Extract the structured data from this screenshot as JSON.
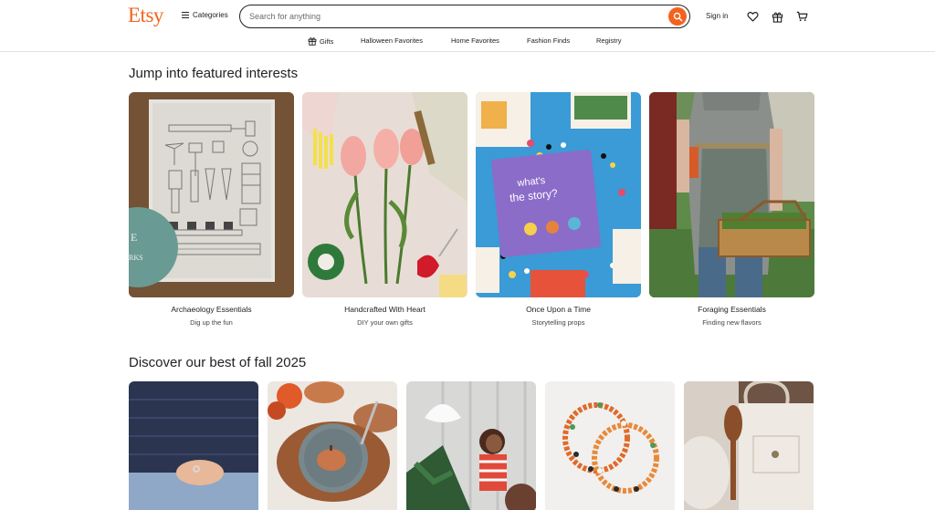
{
  "header": {
    "logo": "Etsy",
    "categories_label": "Categories",
    "search_placeholder": "Search for anything",
    "signin_label": "Sign in",
    "icons": [
      "search-icon",
      "heart-icon",
      "gift-icon",
      "cart-icon"
    ]
  },
  "subnav": {
    "items": [
      "Gifts",
      "Halloween Favorites",
      "Home Favorites",
      "Fashion Finds",
      "Registry"
    ]
  },
  "featured": {
    "title": "Jump into featured interests",
    "cards": [
      {
        "title": "Archaeology Essentials",
        "subtitle": "Dig up the fun"
      },
      {
        "title": "Handcrafted With Heart",
        "subtitle": "DIY your own gifts"
      },
      {
        "title": "Once Upon a Time",
        "subtitle": "Storytelling props"
      },
      {
        "title": "Foraging Essentials",
        "subtitle": "Finding new flavors"
      }
    ]
  },
  "fall": {
    "title": "Discover our best of fall 2025"
  },
  "colors": {
    "brand": "#f1641e",
    "text": "#222222"
  }
}
